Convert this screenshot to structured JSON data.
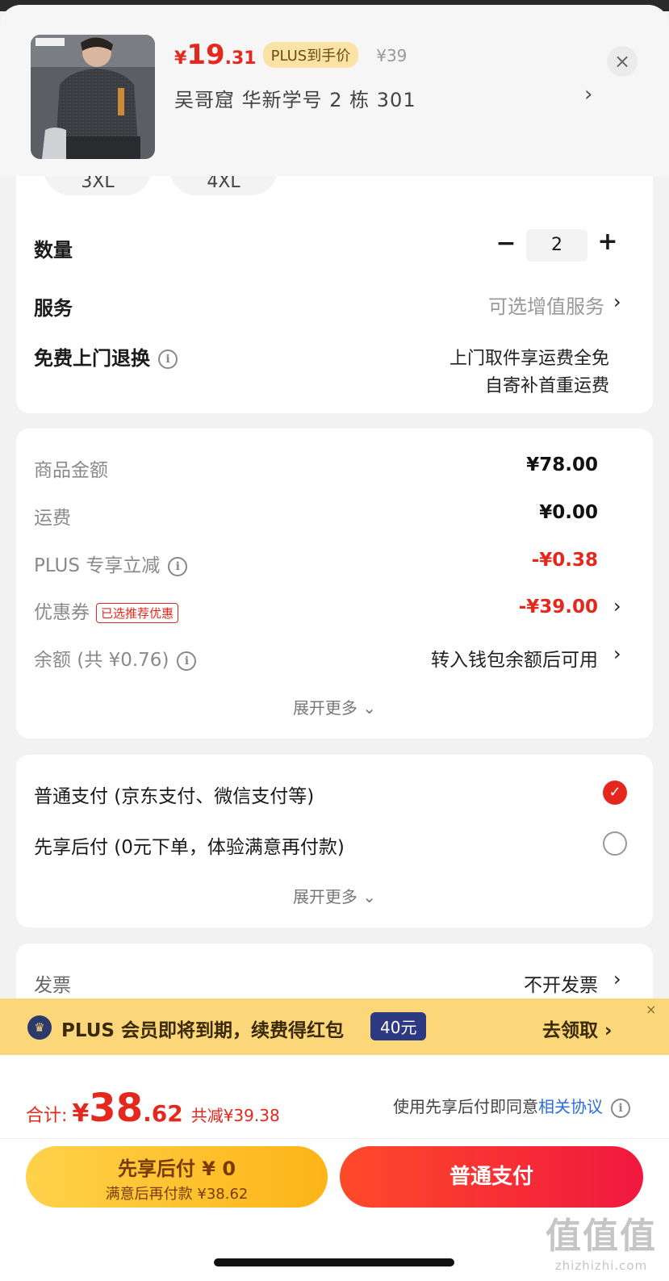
{
  "product": {
    "currency": "¥",
    "price_int": "19",
    "price_dec": ".31",
    "plus_badge": "PLUS到手价",
    "original_price": "¥39",
    "address": "吴哥窟  华新学号 2 栋 301",
    "chevron": "›",
    "close": "×"
  },
  "sizes": [
    "3XL",
    "4XL"
  ],
  "quantity": {
    "label": "数量",
    "minus": "−",
    "value": "2",
    "plus": "+"
  },
  "service": {
    "label": "服务",
    "value": "可选增值服务",
    "chevron": "›"
  },
  "free_return": {
    "label": "免费上门退换",
    "info": "i",
    "line1": "上门取件享运费全免",
    "line2": "自寄补首重运费"
  },
  "fees": {
    "goods_label": "商品金额",
    "goods_value": "¥78.00",
    "shipping_label": "运费",
    "shipping_value": "¥0.00",
    "plus_label": "PLUS 专享立减",
    "plus_value": "-¥0.38",
    "coupon_label": "优惠券",
    "coupon_tag": "已选推荐优惠",
    "coupon_value": "-¥39.00",
    "balance_label": "余额 (共 ¥0.76)",
    "balance_value": "转入钱包余额后可用",
    "expand": "展开更多 ⌄"
  },
  "payment": {
    "option1": "普通支付 (京东支付、微信支付等)",
    "option1_selected": true,
    "option2": "先享后付 (0元下单，体验满意再付款)",
    "option2_selected": false,
    "check": "✓",
    "expand": "展开更多 ⌄"
  },
  "invoice": {
    "label": "发票",
    "value": "不开发票",
    "chevron": "›"
  },
  "banner": {
    "icon": "♛",
    "text": "PLUS 会员即将到期，续费得红包",
    "badge": "40元",
    "cta": "去领取 ›",
    "close": "×"
  },
  "total": {
    "label": "合计:",
    "currency": "¥",
    "int": "38",
    "dec": ".62",
    "saved": "共减¥39.38",
    "agree_text": "使用先享后付即同意",
    "agree_link": "相关协议",
    "info": "i"
  },
  "buttons": {
    "bnpl_line1": "先享后付 ¥ 0",
    "bnpl_line2": "满意后再付款 ¥38.62",
    "pay": "普通支付"
  },
  "watermark": {
    "line1": "值值值",
    "line2": "zhizhizhi.com"
  },
  "colors": {
    "accent_red": "#e4281e",
    "plus_gold": "#fcd77a",
    "link_blue": "#2a6fd6"
  }
}
